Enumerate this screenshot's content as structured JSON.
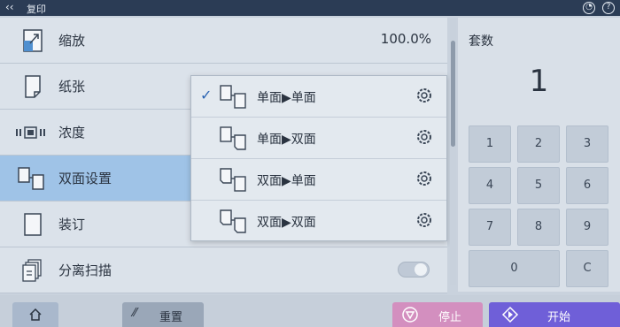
{
  "topbar": {
    "title": "复印"
  },
  "menu": {
    "items": [
      {
        "label": "缩放",
        "value": "100.0%",
        "icon": "zoom-icon"
      },
      {
        "label": "纸张",
        "icon": "paper-icon"
      },
      {
        "label": "浓度",
        "icon": "density-icon"
      },
      {
        "label": "双面设置",
        "icon": "duplex-icon",
        "selected": true
      },
      {
        "label": "装订",
        "icon": "staple-icon"
      },
      {
        "label": "分离扫描",
        "icon": "separate-scan-icon",
        "toggle": false
      }
    ]
  },
  "duplex_popup": {
    "options": [
      {
        "label": "单面▶单面",
        "checked": true
      },
      {
        "label": "单面▶双面",
        "checked": false
      },
      {
        "label": "双面▶单面",
        "checked": false
      },
      {
        "label": "双面▶双面",
        "checked": false
      }
    ]
  },
  "sets": {
    "label": "套数",
    "value": "1"
  },
  "keypad": [
    "1",
    "2",
    "3",
    "4",
    "5",
    "6",
    "7",
    "8",
    "9",
    "0",
    "C"
  ],
  "bottom": {
    "reset_label": "重置",
    "stop_label": "停止",
    "start_label": "开始"
  },
  "colors": {
    "selected_row": "#9fc3e7",
    "stop_button": "#d38fbf",
    "start_button": "#6f5fd8",
    "reset_button": "#9aa7b8",
    "home_button": "#a9b8cc"
  }
}
